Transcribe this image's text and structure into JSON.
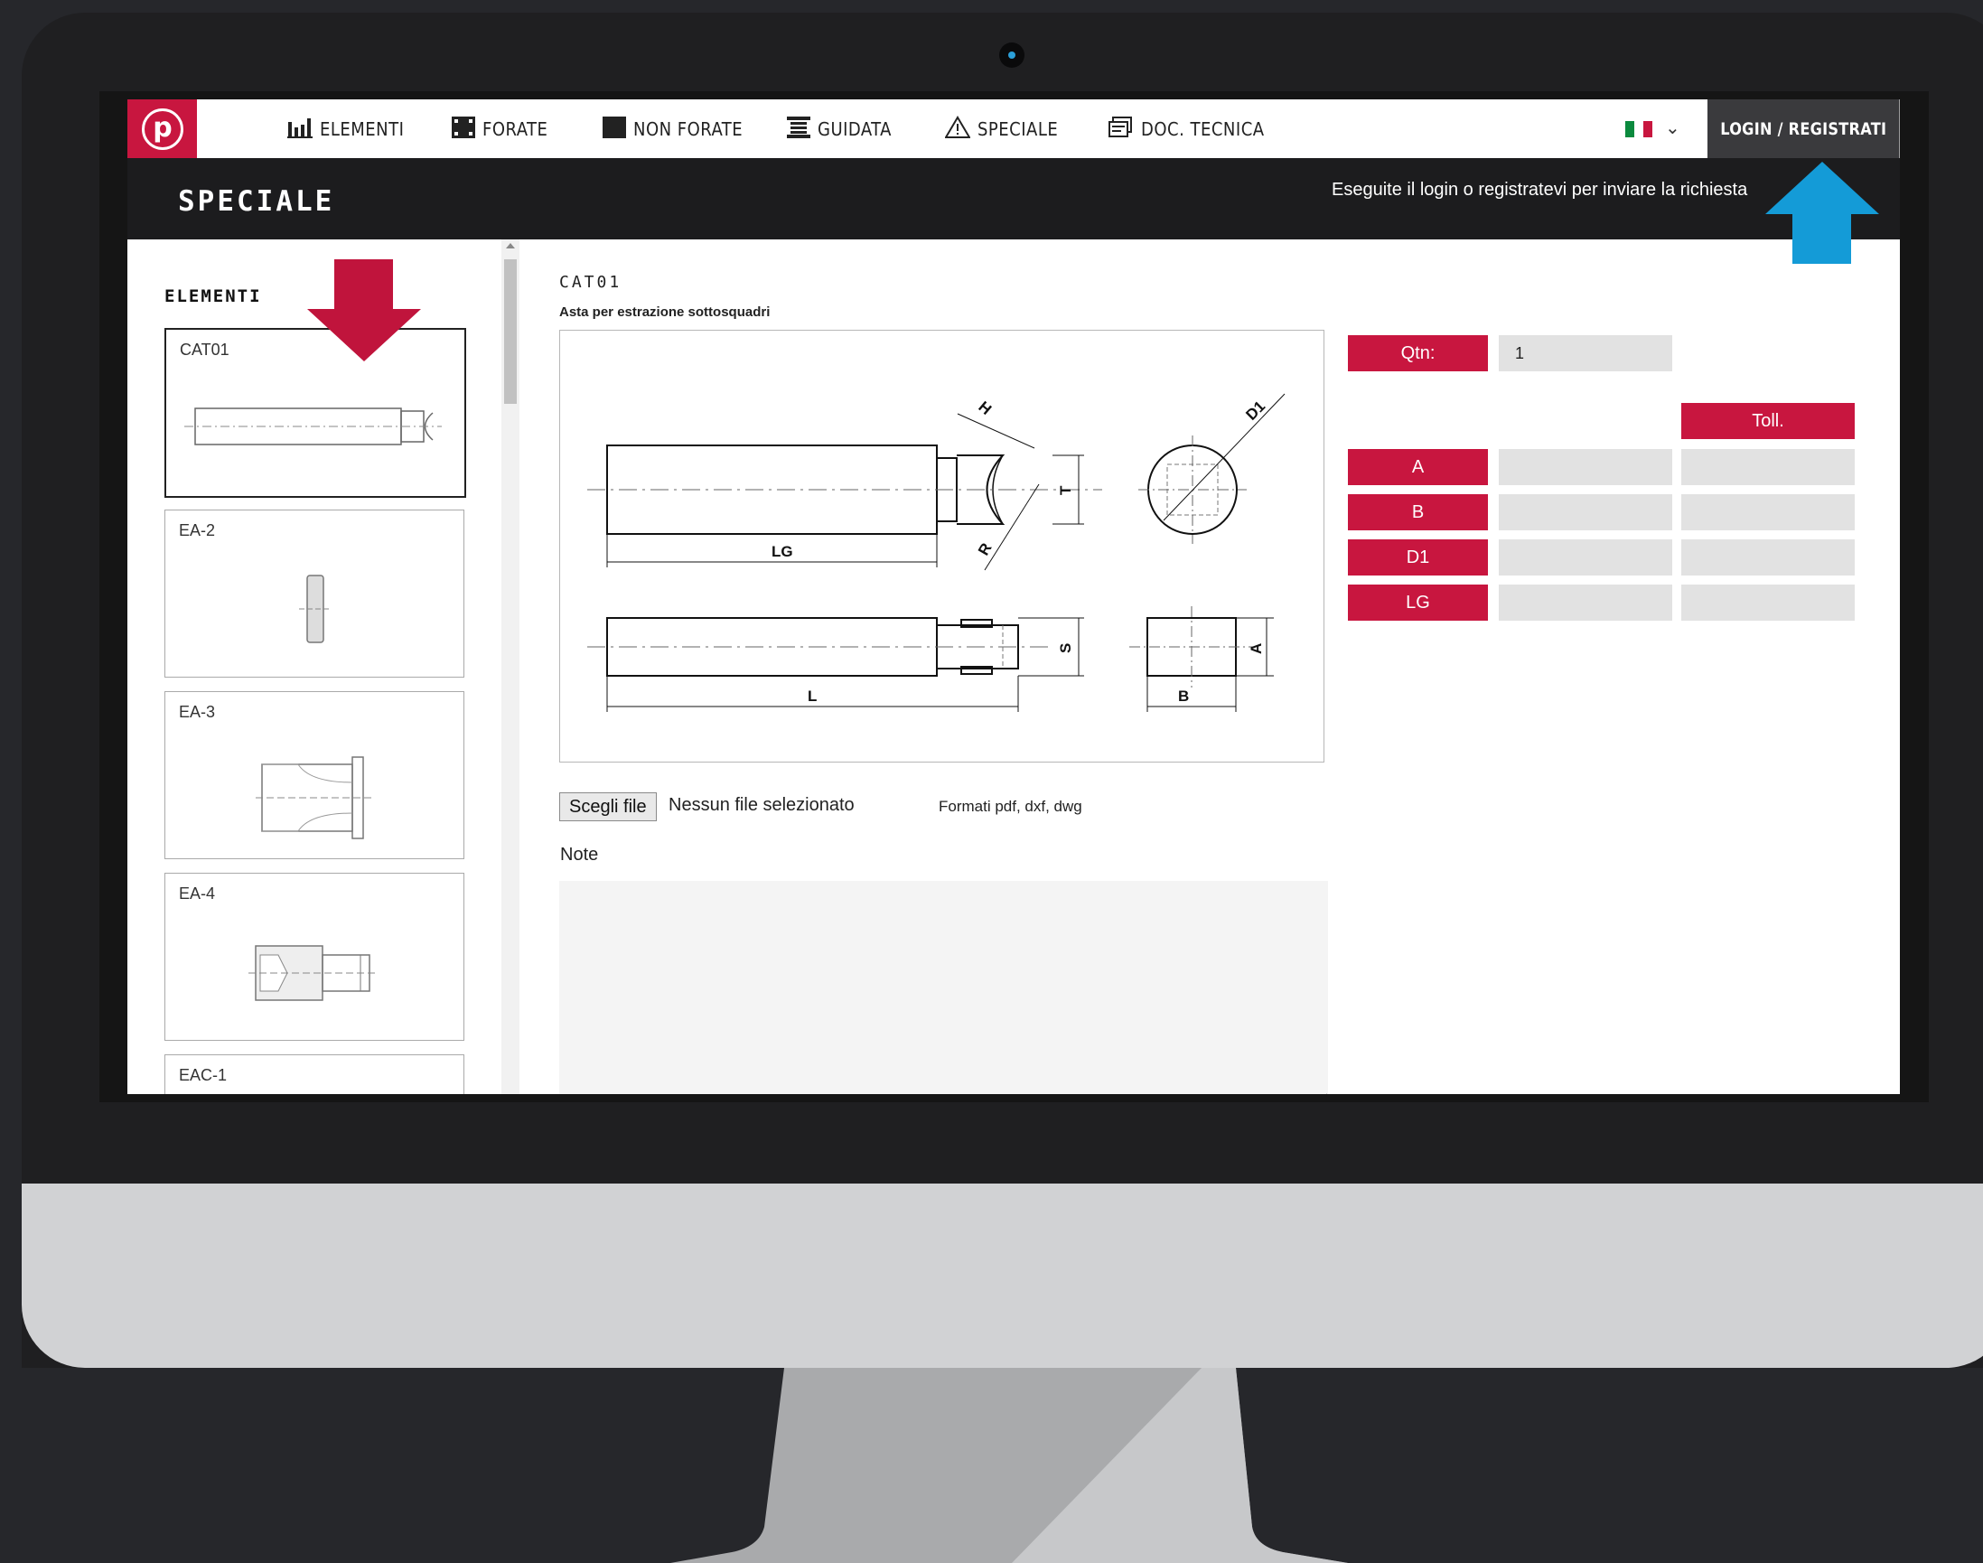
{
  "nav": {
    "items": [
      {
        "label": "ELEMENTI",
        "icon": "bar-chart-icon"
      },
      {
        "label": "FORATE",
        "icon": "square-holes-icon"
      },
      {
        "label": "NON FORATE",
        "icon": "filled-square-icon"
      },
      {
        "label": "GUIDATA",
        "icon": "guide-icon"
      },
      {
        "label": "SPECIALE",
        "icon": "warning-triangle-icon"
      },
      {
        "label": "DOC. TECNICA",
        "icon": "document-icon"
      }
    ],
    "login_label": "LOGIN / REGISTRATI",
    "language_flag": "italian-flag-icon"
  },
  "header": {
    "title": "SPECIALE",
    "message": "Eseguite il login o registratevi per inviare la richiesta"
  },
  "sidebar": {
    "heading": "ELEMENTI",
    "items": [
      "CAT01",
      "EA-2",
      "EA-3",
      "EA-4",
      "EAC-1"
    ]
  },
  "product": {
    "code": "CAT01",
    "description": "Asta per estrazione sottosquadri",
    "drawing_labels": [
      "H",
      "D1",
      "T",
      "R",
      "LG",
      "S",
      "L",
      "A",
      "B"
    ]
  },
  "upload": {
    "button": "Scegli file",
    "status": "Nessun file selezionato",
    "formats": "Formati pdf, dxf, dwg"
  },
  "notes": {
    "label": "Note",
    "value": ""
  },
  "params": {
    "qty_label": "Qtn:",
    "qty_value": "1",
    "toll_label": "Toll.",
    "rows": [
      "A",
      "B",
      "D1",
      "LG"
    ]
  },
  "colors": {
    "accent": "#c8163f",
    "overlay_arrow_red": "#c0143c",
    "overlay_arrow_blue": "#149bd7",
    "dark": "#1c1c1e"
  }
}
